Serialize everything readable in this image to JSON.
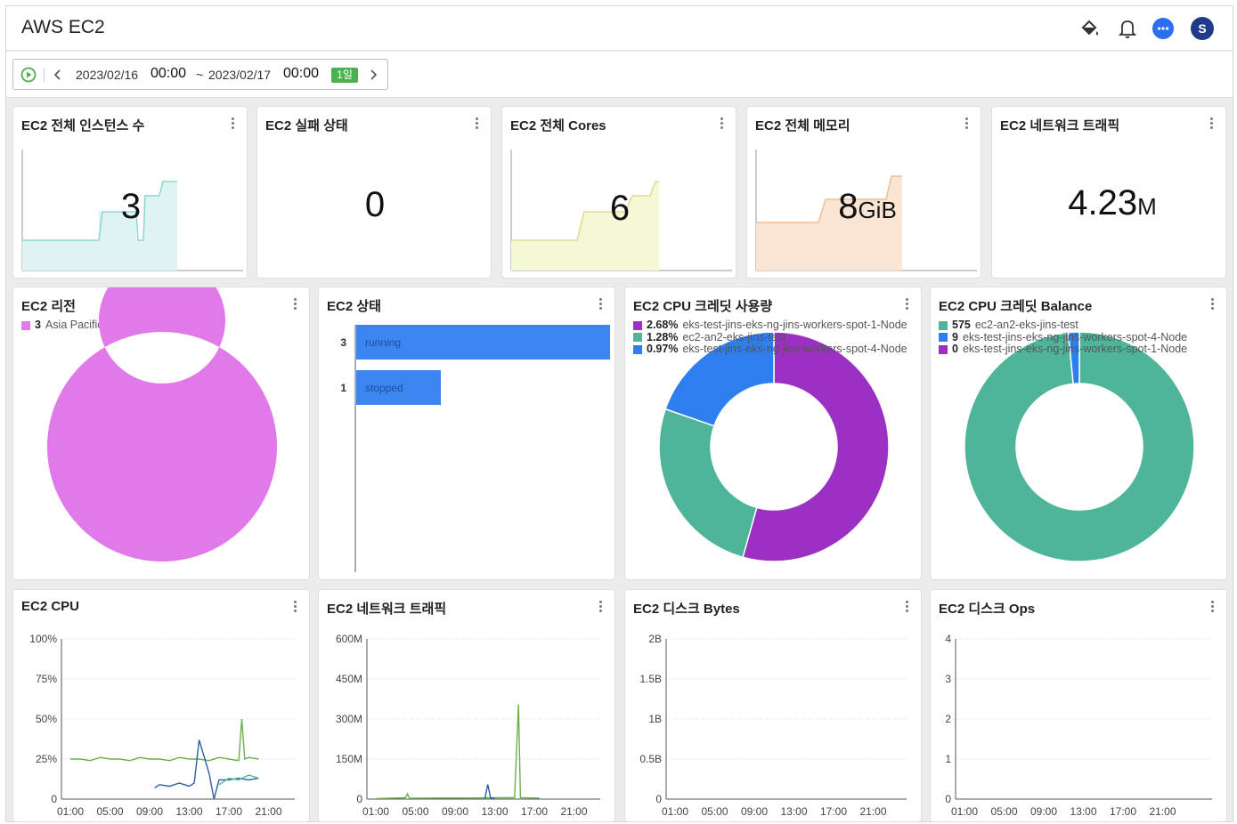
{
  "app": {
    "title": "AWS EC2",
    "icons": [
      "paint-bucket-icon",
      "bell-icon",
      "chat-icon",
      "user-avatar"
    ],
    "avatar_letter": "S"
  },
  "toolbar": {
    "date_from": "2023/02/16",
    "time_from": "00:00",
    "separator": "~",
    "date_to": "2023/02/17",
    "time_to": "00:00",
    "range_badge": "1일"
  },
  "cards": {
    "instances": {
      "title": "EC2 전체 인스턴스 수",
      "value": "3"
    },
    "failed": {
      "title": "EC2 실패 상태",
      "value": "0"
    },
    "cores": {
      "title": "EC2 전체 Cores",
      "value": "6"
    },
    "memory": {
      "title": "EC2 전체 메모리",
      "value": "8",
      "unit": "GiB"
    },
    "network_total": {
      "title": "EC2 네트워크 트래픽",
      "value": "4.23",
      "unit": "M"
    },
    "region": {
      "title": "EC2 리전",
      "legend": [
        {
          "value": "3",
          "label": "Asia Pacific (Seoul)",
          "color": "#e07ae8"
        }
      ]
    },
    "status": {
      "title": "EC2 상태"
    },
    "credit_usage": {
      "title": "EC2 CPU 크레딧 사용량",
      "legend": [
        {
          "value": "2.68%",
          "label": "eks-test-jins-eks-ng-jins-workers-spot-1-Node",
          "color": "#9c2fc4"
        },
        {
          "value": "1.28%",
          "label": "ec2-an2-eks-jins-test",
          "color": "#4fb59a"
        },
        {
          "value": "0.97%",
          "label": "eks-test-jins-eks-ng-jins-workers-spot-4-Node",
          "color": "#2f7ef0"
        }
      ]
    },
    "credit_balance": {
      "title": "EC2 CPU 크레딧 Balance",
      "legend": [
        {
          "value": "575",
          "label": "ec2-an2-eks-jins-test",
          "color": "#4fb59a"
        },
        {
          "value": "9",
          "label": "eks-test-jins-eks-ng-jins-workers-spot-4-Node",
          "color": "#2f7ef0"
        },
        {
          "value": "0",
          "label": "eks-test-jins-eks-ng-jins-workers-spot-1-Node",
          "color": "#9c2fc4"
        }
      ]
    },
    "cpu": {
      "title": "EC2 CPU"
    },
    "network": {
      "title": "EC2 네트워크 트래픽"
    },
    "disk_bytes": {
      "title": "EC2 디스크 Bytes"
    },
    "disk_ops": {
      "title": "EC2 디스크 Ops"
    }
  },
  "chart_data": [
    {
      "type": "pie",
      "title": "EC2 리전",
      "slices": [
        {
          "label": "Asia Pacific (Seoul)",
          "value": 3,
          "color": "#e07ae8"
        }
      ]
    },
    {
      "type": "bar",
      "title": "EC2 상태",
      "orientation": "horizontal",
      "categories": [
        "running",
        "stopped"
      ],
      "values": [
        3,
        1
      ],
      "color": "#3b86f0"
    },
    {
      "type": "pie",
      "title": "EC2 CPU 크레딧 사용량",
      "slices": [
        {
          "label": "eks-test-jins-eks-ng-jins-workers-spot-1-Node",
          "value": 2.68,
          "color": "#9c2fc4"
        },
        {
          "label": "ec2-an2-eks-jins-test",
          "value": 1.28,
          "color": "#4fb59a"
        },
        {
          "label": "eks-test-jins-eks-ng-jins-workers-spot-4-Node",
          "value": 0.97,
          "color": "#2f7ef0"
        }
      ]
    },
    {
      "type": "pie",
      "title": "EC2 CPU 크레딧 Balance",
      "slices": [
        {
          "label": "ec2-an2-eks-jins-test",
          "value": 575,
          "color": "#4fb59a"
        },
        {
          "label": "eks-test-jins-eks-ng-jins-workers-spot-4-Node",
          "value": 9,
          "color": "#2f7ef0"
        },
        {
          "label": "eks-test-jins-eks-ng-jins-workers-spot-1-Node",
          "value": 0,
          "color": "#9c2fc4"
        }
      ]
    },
    {
      "type": "line",
      "title": "EC2 CPU",
      "x_ticks": [
        "01:00",
        "05:00",
        "09:00",
        "13:00",
        "17:00",
        "21:00"
      ],
      "y_ticks": [
        "100%",
        "75%",
        "50%",
        "25%",
        "0"
      ],
      "ylim": [
        0,
        100
      ],
      "series": [
        {
          "color": "#6ab04c",
          "points": [
            [
              0.0,
              25
            ],
            [
              1.0,
              25
            ],
            [
              2.0,
              24
            ],
            [
              3.0,
              26
            ],
            [
              4.0,
              25
            ],
            [
              5.0,
              25
            ],
            [
              6.0,
              24
            ],
            [
              7.0,
              26
            ],
            [
              8.0,
              25
            ],
            [
              9.0,
              25
            ],
            [
              10.0,
              24
            ],
            [
              11.0,
              26
            ],
            [
              12.0,
              25
            ],
            [
              13.0,
              25
            ],
            [
              14.0,
              24
            ],
            [
              15.0,
              26
            ],
            [
              16.0,
              25
            ],
            [
              17.0,
              24
            ],
            [
              17.3,
              50
            ],
            [
              17.6,
              25
            ],
            [
              18.0,
              26
            ],
            [
              19.0,
              25
            ]
          ]
        },
        {
          "color": "#2a5fa8",
          "points": [
            [
              8.5,
              7
            ],
            [
              9.0,
              9
            ],
            [
              10.0,
              8
            ],
            [
              11.0,
              10
            ],
            [
              12.0,
              8
            ],
            [
              12.5,
              10
            ],
            [
              13.0,
              37
            ],
            [
              14.0,
              16
            ],
            [
              14.5,
              0
            ],
            [
              15.0,
              12
            ],
            [
              16.0,
              12
            ],
            [
              17.0,
              13
            ],
            [
              18.0,
              12
            ],
            [
              19.0,
              13
            ]
          ]
        },
        {
          "color": "#4fb59a",
          "points": [
            [
              15.0,
              9
            ],
            [
              16.0,
              13
            ],
            [
              17.0,
              12
            ],
            [
              18.0,
              15
            ],
            [
              19.0,
              13
            ]
          ]
        }
      ]
    },
    {
      "type": "line",
      "title": "EC2 네트워크 트래픽",
      "x_ticks": [
        "01:00",
        "05:00",
        "09:00",
        "13:00",
        "17:00",
        "21:00"
      ],
      "y_ticks": [
        "600M",
        "450M",
        "300M",
        "150M",
        "0"
      ],
      "ylim": [
        0,
        600
      ],
      "series": [
        {
          "color": "#6ab04c",
          "points": [
            [
              0.0,
              2
            ],
            [
              3.0,
              5
            ],
            [
              3.2,
              20
            ],
            [
              3.4,
              3
            ],
            [
              6.0,
              4
            ],
            [
              9.0,
              4
            ],
            [
              12.0,
              5
            ],
            [
              14.0,
              5
            ],
            [
              14.4,
              355
            ],
            [
              14.6,
              5
            ],
            [
              16.0,
              4
            ],
            [
              16.5,
              4
            ]
          ]
        },
        {
          "color": "#2a5fa8",
          "points": [
            [
              11.0,
              2
            ],
            [
              11.3,
              55
            ],
            [
              11.6,
              3
            ],
            [
              12.0,
              2
            ]
          ]
        }
      ]
    },
    {
      "type": "line",
      "title": "EC2 디스크 Bytes",
      "x_ticks": [
        "01:00",
        "05:00",
        "09:00",
        "13:00",
        "17:00",
        "21:00"
      ],
      "y_ticks": [
        "2B",
        "1.5B",
        "1B",
        "0.5B",
        "0"
      ],
      "ylim": [
        0,
        2
      ],
      "series": []
    },
    {
      "type": "line",
      "title": "EC2 디스크 Ops",
      "x_ticks": [
        "01:00",
        "05:00",
        "09:00",
        "13:00",
        "17:00",
        "21:00"
      ],
      "y_ticks": [
        "4",
        "3",
        "2",
        "1",
        "0"
      ],
      "ylim": [
        0,
        4
      ],
      "series": []
    }
  ]
}
